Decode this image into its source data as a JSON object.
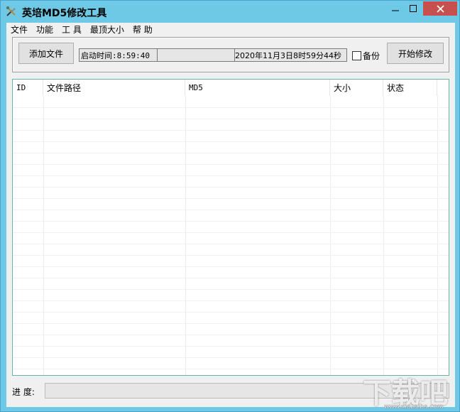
{
  "window": {
    "title": "英培MD5修改工具",
    "icon": "tools-icon",
    "accent_color": "#6ec9e6",
    "close_color": "#c7504f"
  },
  "menu": {
    "items": [
      {
        "label": "文件"
      },
      {
        "label": "功能"
      },
      {
        "label": "工 具"
      },
      {
        "label": "最顶大小"
      },
      {
        "label": "帮 助"
      }
    ]
  },
  "toolbar": {
    "add_label": "添加文件",
    "start_label": "开始修改",
    "backup_label": "备份",
    "backup_checked": false
  },
  "status": {
    "start_time": "启动时间:8:59:40",
    "middle": "",
    "datetime": "2020年11月3日8时59分44秒"
  },
  "table": {
    "columns": [
      "ID",
      "文件路径",
      "MD5",
      "大小",
      "状态"
    ],
    "rows": []
  },
  "progress": {
    "label": "进 度:",
    "value": 0
  },
  "watermark": {
    "text": "下载吧",
    "url": "www.xiazaiba.com"
  }
}
